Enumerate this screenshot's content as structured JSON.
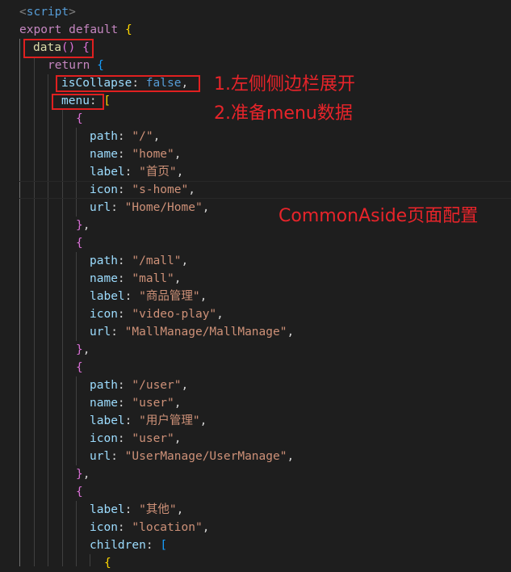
{
  "code": {
    "script_open": "script",
    "export": "export",
    "default": "default",
    "data_fn": "data",
    "return": "return",
    "isCollapse_key": "isCollapse",
    "false": "false",
    "menu_key": "menu",
    "path_key": "path",
    "name_key": "name",
    "label_key": "label",
    "icon_key": "icon",
    "url_key": "url",
    "children_key": "children",
    "items": [
      {
        "path": "\"/\"",
        "name": "\"home\"",
        "label": "\"首页\"",
        "icon": "\"s-home\"",
        "url": "\"Home/Home\""
      },
      {
        "path": "\"/mall\"",
        "name": "\"mall\"",
        "label": "\"商品管理\"",
        "icon": "\"video-play\"",
        "url": "\"MallManage/MallManage\""
      },
      {
        "path": "\"/user\"",
        "name": "\"user\"",
        "label": "\"用户管理\"",
        "icon": "\"user\"",
        "url": "\"UserManage/UserManage\""
      },
      {
        "label": "\"其他\"",
        "icon": "\"location\""
      }
    ]
  },
  "annotations": {
    "note1": "1.左侧侧边栏展开",
    "note2": "2.准备menu数据",
    "note3": "CommonAside页面配置"
  }
}
